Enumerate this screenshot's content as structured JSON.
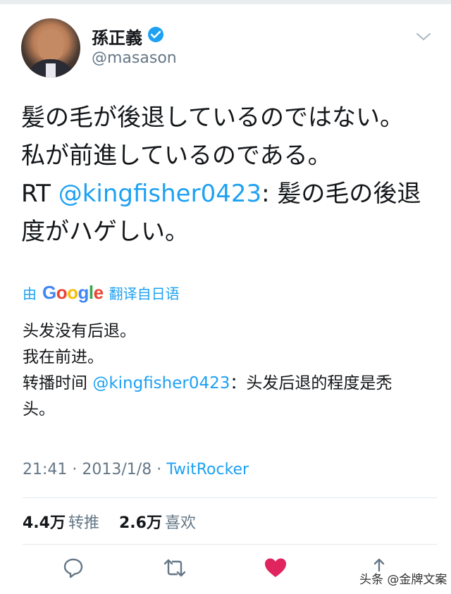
{
  "user": {
    "display_name": "孫正義",
    "handle": "@masason"
  },
  "tweet": {
    "line1": "髪の毛が後退しているのではない。",
    "line2": "私が前進しているのである。",
    "line3_prefix": " RT ",
    "line3_mention": "@kingfisher0423",
    "line3_rest": ": 髪の毛の後退",
    "line4": "度がハゲしい。"
  },
  "translation": {
    "prefix": "由",
    "suffix": "翻译自日语",
    "line1": "头发没有后退。",
    "line2": "我在前进。",
    "line3_prefix": "转播时间 ",
    "line3_mention": "@kingfisher0423",
    "line3_rest": "：头发后退的程度是秃",
    "line4": "头。"
  },
  "meta": {
    "time": "21:41",
    "date": "2013/1/8",
    "source": "TwitRocker",
    "sep": " · "
  },
  "stats": {
    "retweets_count": "4.4万",
    "retweets_label": "转推",
    "likes_count": "2.6万",
    "likes_label": "喜欢"
  },
  "watermark": "头条 @金牌文案",
  "colors": {
    "accent": "#1da1f2",
    "like": "#e0245e",
    "muted": "#657786"
  }
}
